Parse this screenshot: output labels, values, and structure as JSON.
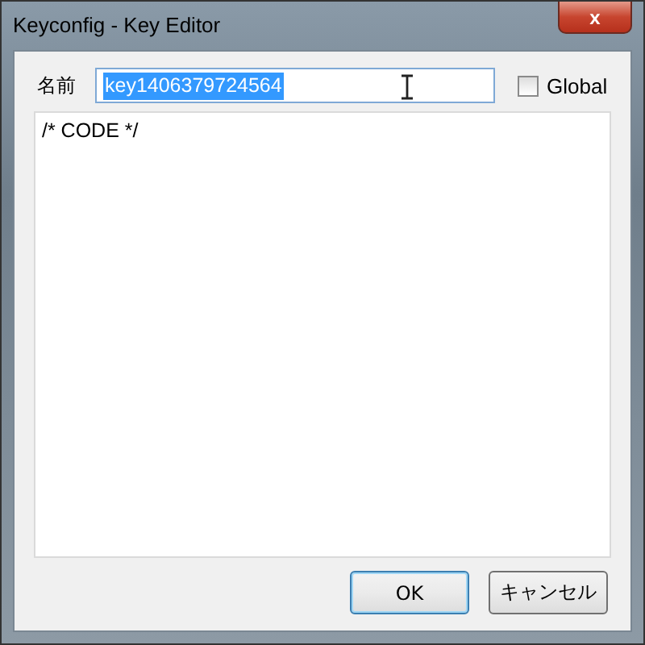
{
  "window": {
    "title": "Keyconfig - Key Editor",
    "close_label": "x"
  },
  "name_field": {
    "label": "名前",
    "value": "key1406379724564",
    "text_selected": true
  },
  "global_checkbox": {
    "label": "Global",
    "checked": false
  },
  "code_editor": {
    "value": "/* CODE */"
  },
  "buttons": [
    {
      "label": "OK",
      "default": true
    },
    {
      "label": "キャンセル",
      "default": false
    }
  ]
}
